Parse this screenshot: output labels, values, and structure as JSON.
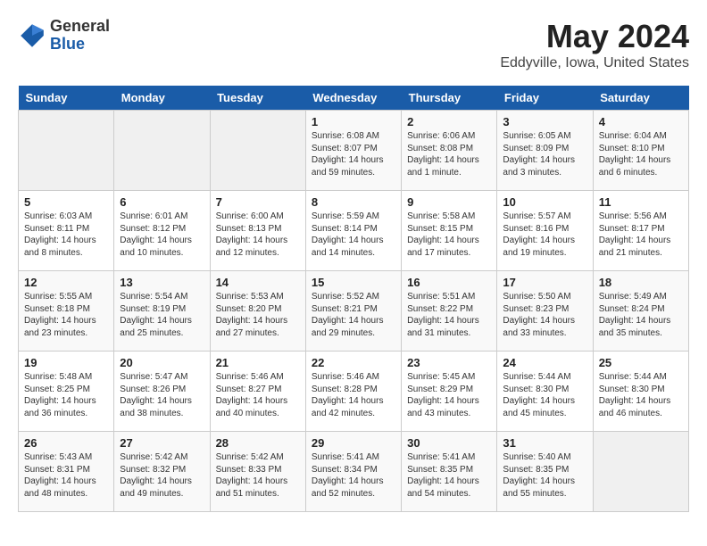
{
  "header": {
    "logo_general": "General",
    "logo_blue": "Blue",
    "month_title": "May 2024",
    "location": "Eddyville, Iowa, United States"
  },
  "days_of_week": [
    "Sunday",
    "Monday",
    "Tuesday",
    "Wednesday",
    "Thursday",
    "Friday",
    "Saturday"
  ],
  "weeks": [
    [
      {
        "day": "",
        "info": ""
      },
      {
        "day": "",
        "info": ""
      },
      {
        "day": "",
        "info": ""
      },
      {
        "day": "1",
        "info": "Sunrise: 6:08 AM\nSunset: 8:07 PM\nDaylight: 14 hours\nand 59 minutes."
      },
      {
        "day": "2",
        "info": "Sunrise: 6:06 AM\nSunset: 8:08 PM\nDaylight: 14 hours\nand 1 minute."
      },
      {
        "day": "3",
        "info": "Sunrise: 6:05 AM\nSunset: 8:09 PM\nDaylight: 14 hours\nand 3 minutes."
      },
      {
        "day": "4",
        "info": "Sunrise: 6:04 AM\nSunset: 8:10 PM\nDaylight: 14 hours\nand 6 minutes."
      }
    ],
    [
      {
        "day": "5",
        "info": "Sunrise: 6:03 AM\nSunset: 8:11 PM\nDaylight: 14 hours\nand 8 minutes."
      },
      {
        "day": "6",
        "info": "Sunrise: 6:01 AM\nSunset: 8:12 PM\nDaylight: 14 hours\nand 10 minutes."
      },
      {
        "day": "7",
        "info": "Sunrise: 6:00 AM\nSunset: 8:13 PM\nDaylight: 14 hours\nand 12 minutes."
      },
      {
        "day": "8",
        "info": "Sunrise: 5:59 AM\nSunset: 8:14 PM\nDaylight: 14 hours\nand 14 minutes."
      },
      {
        "day": "9",
        "info": "Sunrise: 5:58 AM\nSunset: 8:15 PM\nDaylight: 14 hours\nand 17 minutes."
      },
      {
        "day": "10",
        "info": "Sunrise: 5:57 AM\nSunset: 8:16 PM\nDaylight: 14 hours\nand 19 minutes."
      },
      {
        "day": "11",
        "info": "Sunrise: 5:56 AM\nSunset: 8:17 PM\nDaylight: 14 hours\nand 21 minutes."
      }
    ],
    [
      {
        "day": "12",
        "info": "Sunrise: 5:55 AM\nSunset: 8:18 PM\nDaylight: 14 hours\nand 23 minutes."
      },
      {
        "day": "13",
        "info": "Sunrise: 5:54 AM\nSunset: 8:19 PM\nDaylight: 14 hours\nand 25 minutes."
      },
      {
        "day": "14",
        "info": "Sunrise: 5:53 AM\nSunset: 8:20 PM\nDaylight: 14 hours\nand 27 minutes."
      },
      {
        "day": "15",
        "info": "Sunrise: 5:52 AM\nSunset: 8:21 PM\nDaylight: 14 hours\nand 29 minutes."
      },
      {
        "day": "16",
        "info": "Sunrise: 5:51 AM\nSunset: 8:22 PM\nDaylight: 14 hours\nand 31 minutes."
      },
      {
        "day": "17",
        "info": "Sunrise: 5:50 AM\nSunset: 8:23 PM\nDaylight: 14 hours\nand 33 minutes."
      },
      {
        "day": "18",
        "info": "Sunrise: 5:49 AM\nSunset: 8:24 PM\nDaylight: 14 hours\nand 35 minutes."
      }
    ],
    [
      {
        "day": "19",
        "info": "Sunrise: 5:48 AM\nSunset: 8:25 PM\nDaylight: 14 hours\nand 36 minutes."
      },
      {
        "day": "20",
        "info": "Sunrise: 5:47 AM\nSunset: 8:26 PM\nDaylight: 14 hours\nand 38 minutes."
      },
      {
        "day": "21",
        "info": "Sunrise: 5:46 AM\nSunset: 8:27 PM\nDaylight: 14 hours\nand 40 minutes."
      },
      {
        "day": "22",
        "info": "Sunrise: 5:46 AM\nSunset: 8:28 PM\nDaylight: 14 hours\nand 42 minutes."
      },
      {
        "day": "23",
        "info": "Sunrise: 5:45 AM\nSunset: 8:29 PM\nDaylight: 14 hours\nand 43 minutes."
      },
      {
        "day": "24",
        "info": "Sunrise: 5:44 AM\nSunset: 8:30 PM\nDaylight: 14 hours\nand 45 minutes."
      },
      {
        "day": "25",
        "info": "Sunrise: 5:44 AM\nSunset: 8:30 PM\nDaylight: 14 hours\nand 46 minutes."
      }
    ],
    [
      {
        "day": "26",
        "info": "Sunrise: 5:43 AM\nSunset: 8:31 PM\nDaylight: 14 hours\nand 48 minutes."
      },
      {
        "day": "27",
        "info": "Sunrise: 5:42 AM\nSunset: 8:32 PM\nDaylight: 14 hours\nand 49 minutes."
      },
      {
        "day": "28",
        "info": "Sunrise: 5:42 AM\nSunset: 8:33 PM\nDaylight: 14 hours\nand 51 minutes."
      },
      {
        "day": "29",
        "info": "Sunrise: 5:41 AM\nSunset: 8:34 PM\nDaylight: 14 hours\nand 52 minutes."
      },
      {
        "day": "30",
        "info": "Sunrise: 5:41 AM\nSunset: 8:35 PM\nDaylight: 14 hours\nand 54 minutes."
      },
      {
        "day": "31",
        "info": "Sunrise: 5:40 AM\nSunset: 8:35 PM\nDaylight: 14 hours\nand 55 minutes."
      },
      {
        "day": "",
        "info": ""
      }
    ]
  ]
}
